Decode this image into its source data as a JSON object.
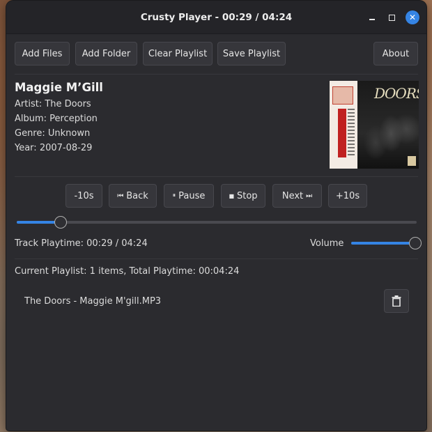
{
  "window": {
    "title": "Crusty Player - 00:29 / 04:24"
  },
  "toolbar": {
    "add_files": "Add Files",
    "add_folder": "Add Folder",
    "clear_playlist": "Clear Playlist",
    "save_playlist": "Save Playlist",
    "about": "About"
  },
  "track": {
    "title": "Maggie M’Gill",
    "artist_label": "Artist: ",
    "artist": "The Doors",
    "album_label": "Album: ",
    "album": "Perception",
    "genre_label": "Genre: ",
    "genre": "Unknown",
    "year_label": "Year: ",
    "year": "2007-08-29",
    "cover_text": "DOORS"
  },
  "controls": {
    "back10": "-10s",
    "back_icon": "⏮",
    "back": "Back",
    "pause_icon": "⏸",
    "pause": "Pause",
    "stop_icon": "■",
    "stop": "Stop",
    "next": "Next",
    "next_icon": "⏭",
    "fwd10": "+10s"
  },
  "progress": {
    "fraction": 0.11
  },
  "status": {
    "playtime": "Track Playtime: 00:29 / 04:24",
    "volume_label": "Volume",
    "volume_fraction": 1.0
  },
  "playlist": {
    "summary": "Current Playlist: 1 items, Total Playtime: 00:04:24",
    "items": [
      {
        "name": "The Doors - Maggie M'gill.MP3"
      }
    ]
  },
  "colors": {
    "accent": "#3584e4",
    "window_bg": "#2b2b2f",
    "titlebar_bg": "#242428"
  },
  "icons": {
    "minimize": "minimize-icon",
    "maximize": "maximize-icon",
    "close": "close-icon",
    "delete": "trash-icon"
  }
}
